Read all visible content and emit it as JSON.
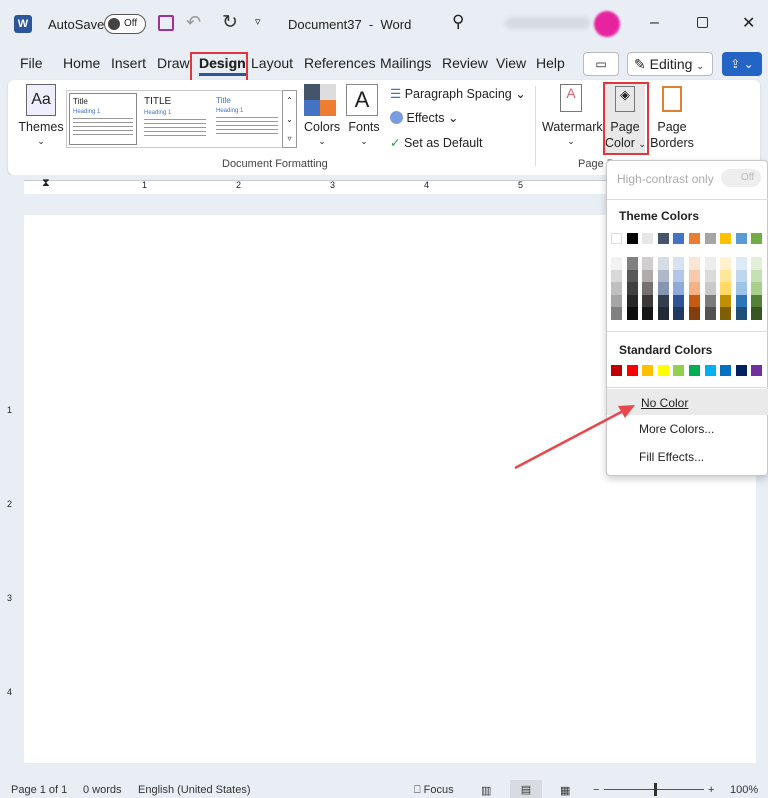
{
  "titlebar": {
    "autosave": "AutoSave",
    "toggle": "Off",
    "doc_title": "Document37  -  Word"
  },
  "tabs": [
    "File",
    "Home",
    "Insert",
    "Draw",
    "Design",
    "Layout",
    "References",
    "Mailings",
    "Review",
    "View",
    "Help"
  ],
  "active_tab": "Design",
  "editing": "Editing",
  "ribbon": {
    "themes": "Themes",
    "styles": [
      {
        "title": "Title",
        "heading": "Heading 1"
      },
      {
        "title": "TITLE",
        "heading": "Heading 1"
      },
      {
        "title": "Title",
        "heading": "Heading 1"
      }
    ],
    "colors": "Colors",
    "fonts": "Fonts",
    "paragraph_spacing": "Paragraph Spacing",
    "effects": "Effects",
    "set_default": "Set as Default",
    "group_doc_formatting": "Document Formatting",
    "watermark": "Watermark",
    "page_color_1": "Page",
    "page_color_2": "Color",
    "page_borders_1": "Page",
    "page_borders_2": "Borders",
    "group_page": "Page B"
  },
  "menu": {
    "high_contrast": "High-contrast only",
    "hc_toggle": "Off",
    "theme_colors_label": "Theme Colors",
    "theme_base": [
      "#FFFFFF",
      "#000000",
      "#E7E6E6",
      "#44546A",
      "#4472C4",
      "#ED7D31",
      "#A5A5A5",
      "#FFC000",
      "#5B9BD5",
      "#70AD47"
    ],
    "theme_shades": [
      [
        "#F2F2F2",
        "#D9D9D9",
        "#BFBFBF",
        "#A6A6A6",
        "#808080"
      ],
      [
        "#808080",
        "#595959",
        "#404040",
        "#262626",
        "#0D0D0D"
      ],
      [
        "#D0CECE",
        "#AEABAB",
        "#757171",
        "#3B3838",
        "#171616"
      ],
      [
        "#D6DCE4",
        "#ADB9CA",
        "#8496B0",
        "#333F4F",
        "#222A35"
      ],
      [
        "#D9E2F3",
        "#B4C6E7",
        "#8EAADB",
        "#2F5496",
        "#1F3864"
      ],
      [
        "#FBE5D5",
        "#F7CAAC",
        "#F4B183",
        "#C55A11",
        "#833C0B"
      ],
      [
        "#EDEDED",
        "#DBDBDB",
        "#C9C9C9",
        "#7B7B7B",
        "#525252"
      ],
      [
        "#FFF2CC",
        "#FFE699",
        "#FFD966",
        "#BF9000",
        "#7F6000"
      ],
      [
        "#DEEBF6",
        "#BDD7EE",
        "#9DC3E6",
        "#2E75B5",
        "#1F4E79"
      ],
      [
        "#E2EFD9",
        "#C5E0B3",
        "#A8D08D",
        "#538135",
        "#375623"
      ]
    ],
    "standard_colors_label": "Standard Colors",
    "standard": [
      "#C00000",
      "#FF0000",
      "#FFC000",
      "#FFFF00",
      "#92D050",
      "#00B050",
      "#00B0F0",
      "#0070C0",
      "#002060",
      "#7030A0"
    ],
    "no_color": "No Color",
    "more_colors": "More Colors...",
    "fill_effects": "Fill Effects..."
  },
  "ruler_numbers": [
    "1",
    "2",
    "3",
    "4",
    "5"
  ],
  "vruler_numbers": [
    "1",
    "2",
    "3",
    "4"
  ],
  "status": {
    "page": "Page 1 of 1",
    "words": "0 words",
    "language": "English (United States)",
    "focus": "Focus",
    "zoom": "100%",
    "zoom_level_percent": 100
  },
  "accent": "#2b579a",
  "highlight": "#e0363c"
}
